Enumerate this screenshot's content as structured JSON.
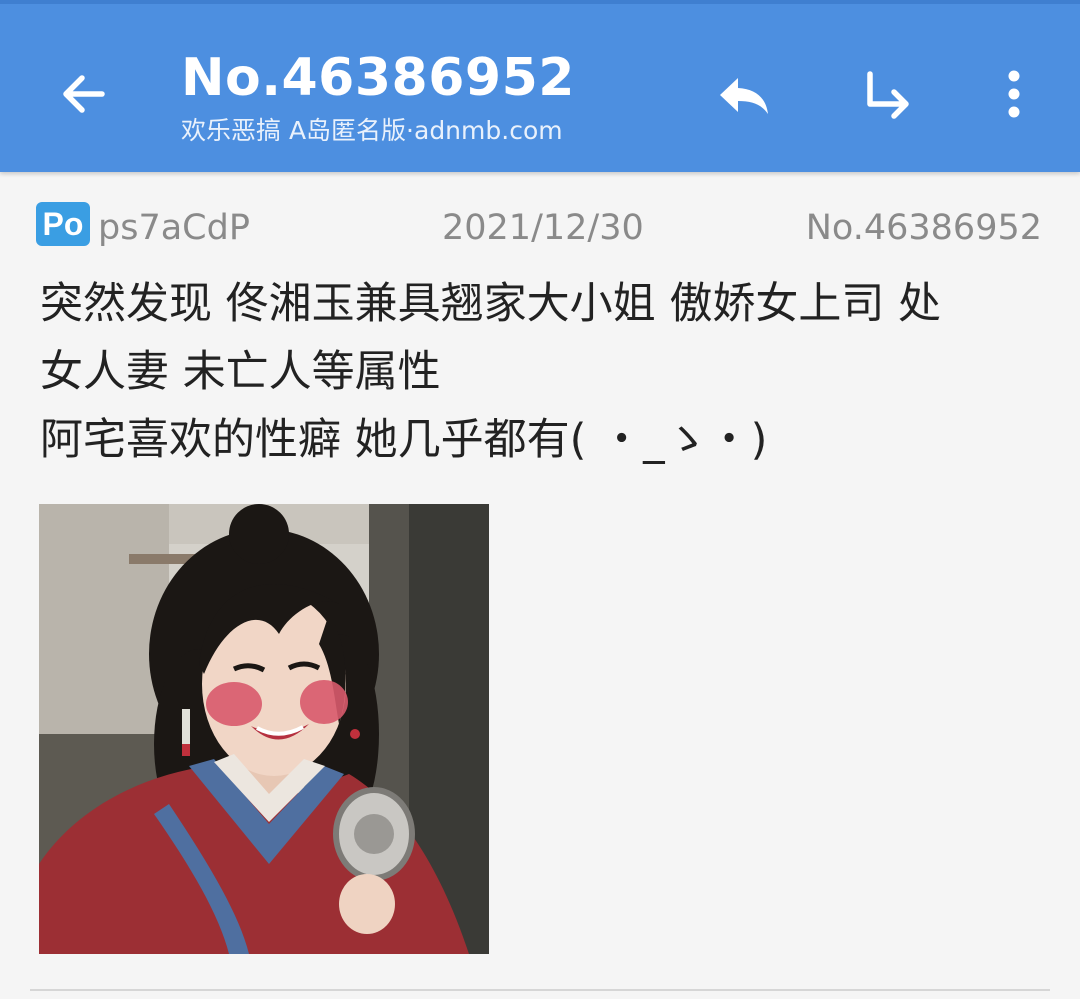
{
  "appbar": {
    "title": "No.46386952",
    "subtitle": "欢乐恶搞 A岛匿名版·adnmb.com",
    "icons": [
      "arrow-left-icon",
      "reply-icon",
      "share-forward-icon",
      "more-vert-icon"
    ],
    "background_color": "#4d8fe0"
  },
  "post": {
    "po_badge": "Po",
    "uid": "ps7aCdP",
    "date": "2021/12/30",
    "number": "No.46386952",
    "content_lines": [
      "突然发现 佟湘玉兼具翘家大小姐 傲娇女上司 处",
      "女人妻 未亡人等属性",
      "阿宅喜欢的性癖 她几乎都有( ・_ゝ・)"
    ],
    "badge_color": "#3a9ee3"
  }
}
